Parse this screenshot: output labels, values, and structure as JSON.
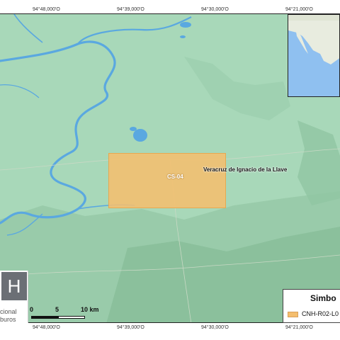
{
  "coords": {
    "top": [
      "94°48,000'O",
      "94°39,000'O",
      "94°30,000'O",
      "94°21,000'O"
    ],
    "bottom": [
      "94°48,000'O",
      "94°39,000'O",
      "94°30,000'O",
      "94°21,000'O"
    ]
  },
  "map": {
    "block_label": "CS-04",
    "state_label": "Veracruz de Ignacio de la Llave"
  },
  "logo": {
    "mark": "H",
    "line1": "cional",
    "line2": "buros"
  },
  "scale": {
    "labels": [
      "0",
      "5",
      "10 km"
    ]
  },
  "legend": {
    "title": "Simbo",
    "item": "CNH-R02-L0"
  },
  "colors": {
    "land": "#a8d8b9",
    "water": "#5aa8e0",
    "block": "#f4be6e"
  }
}
